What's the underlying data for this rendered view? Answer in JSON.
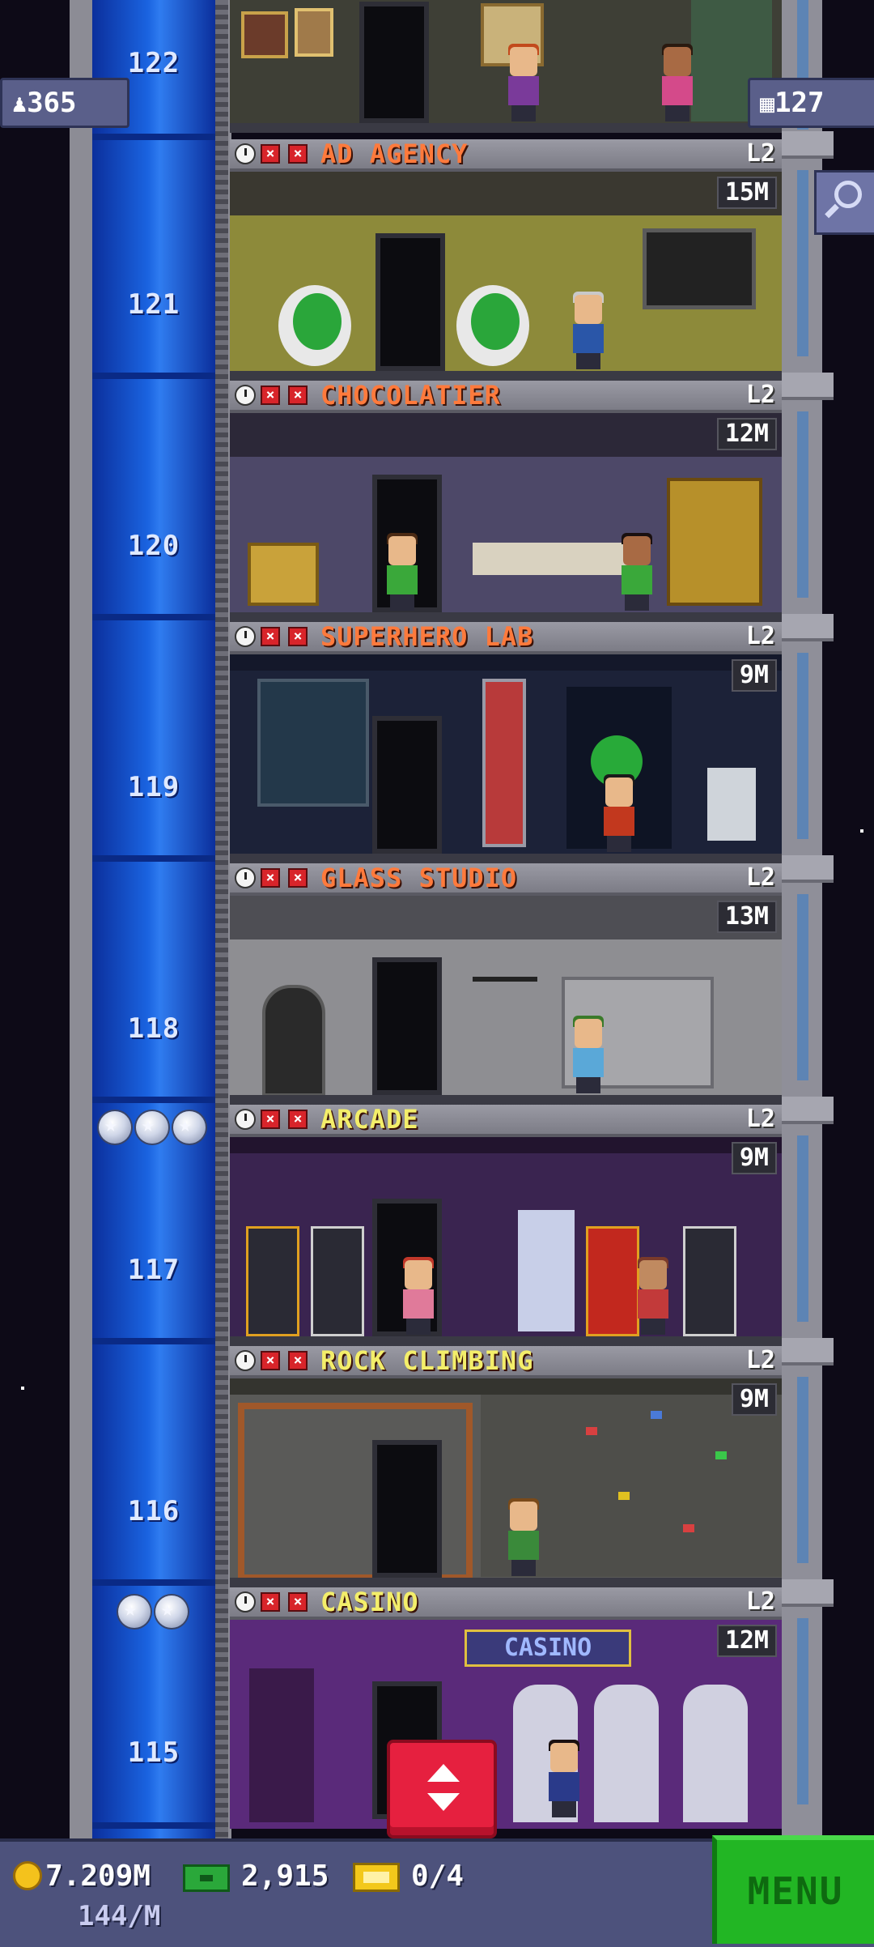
{
  "hud": {
    "population": "365",
    "floors": "127"
  },
  "floors": [
    {
      "number": "122"
    },
    {
      "number": "121",
      "name": "AD AGENCY",
      "level": "L2",
      "price": "15M",
      "color": "#ff7a3c"
    },
    {
      "number": "120",
      "name": "CHOCOLATIER",
      "level": "L2",
      "price": "12M",
      "color": "#ff7a3c"
    },
    {
      "number": "119",
      "name": "SUPERHERO LAB",
      "level": "L2",
      "price": "9M",
      "color": "#ff7a3c"
    },
    {
      "number": "118",
      "name": "GLASS STUDIO",
      "level": "L2",
      "price": "13M",
      "color": "#ff7a3c"
    },
    {
      "number": "117",
      "name": "ARCADE",
      "level": "L2",
      "price": "9M",
      "color": "#f3ee6a",
      "stars": 3
    },
    {
      "number": "116",
      "name": "ROCK CLIMBING",
      "level": "L2",
      "price": "9M",
      "color": "#f3ee6a"
    },
    {
      "number": "115",
      "name": "CASINO",
      "level": "L2",
      "price": "12M",
      "color": "#f3ee6a",
      "stars": 2
    }
  ],
  "casino_sign": "CASINO",
  "bottom": {
    "coins": "7.209M",
    "coins_rate": "144/M",
    "bux": "2,915",
    "tickets": "0/4",
    "menu_label": "MENU"
  },
  "colors": {
    "shaft": "#1a63e0",
    "menu": "#22b624",
    "elevator_button": "#e6203f",
    "hud": "#5a5f8a"
  }
}
